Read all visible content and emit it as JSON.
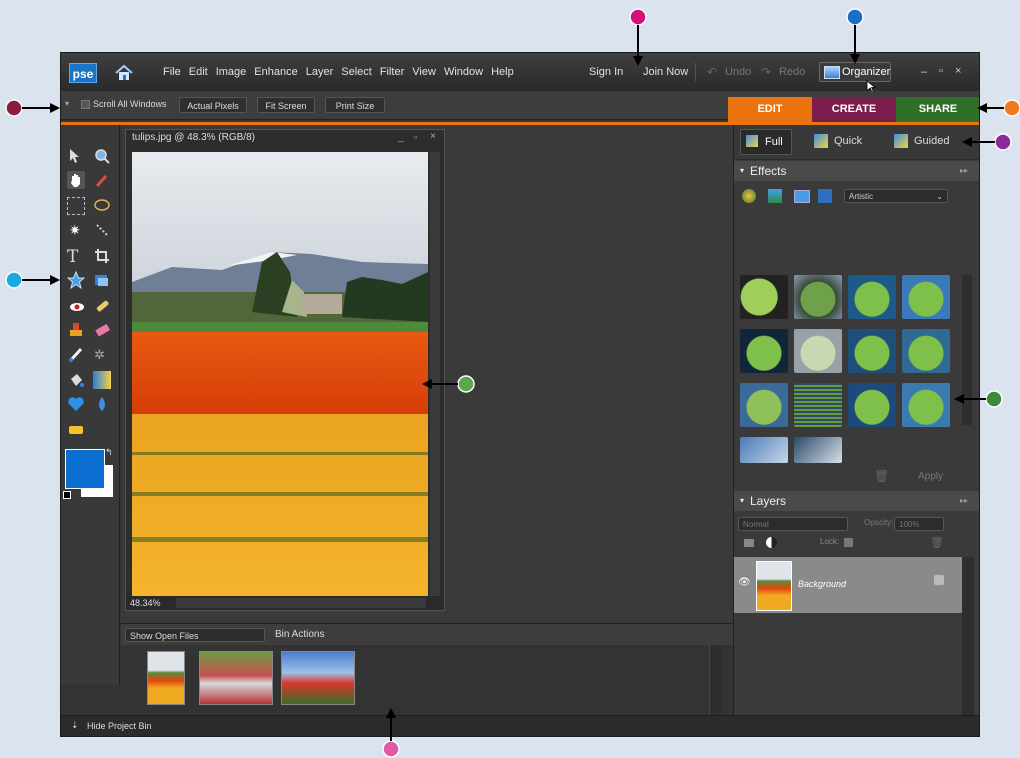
{
  "app": {
    "logo": "pse",
    "menus": [
      "File",
      "Edit",
      "Image",
      "Enhance",
      "Layer",
      "Select",
      "Filter",
      "View",
      "Window",
      "Help"
    ],
    "sign_in": "Sign In",
    "join_now": "Join Now",
    "undo": "Undo",
    "redo": "Redo",
    "organizer": "Organizer",
    "window_controls": [
      "–",
      "▫",
      "×"
    ]
  },
  "options": {
    "scroll_all": "Scroll All Windows",
    "actual_pixels": "Actual Pixels",
    "fit_screen": "Fit Screen",
    "print_size": "Print Size"
  },
  "tabs": [
    {
      "label": "EDIT",
      "color": "#e8730f"
    },
    {
      "label": "CREATE",
      "color": "#8a2152"
    },
    {
      "label": "SHARE",
      "color": "#3c7a2e"
    }
  ],
  "modes": {
    "full": "Full",
    "quick": "Quick",
    "guided": "Guided"
  },
  "document": {
    "title": "tulips.jpg @ 48.3% (RGB/8)",
    "zoom": "48.34%"
  },
  "effects": {
    "header": "Effects",
    "category": "Artistic",
    "apply": "Apply"
  },
  "layers": {
    "header": "Layers",
    "blend_mode": "Normal",
    "opacity_label": "Opacity:",
    "opacity_value": "100%",
    "lock_label": "Lock:",
    "layer_name": "Background"
  },
  "bin": {
    "show": "Show Open Files",
    "actions": "Bin Actions",
    "hide": "Hide Project Bin"
  },
  "callout_colors": {
    "maroon": "#8b1d3f",
    "magenta": "#d1127a",
    "blue": "#1a6fc4",
    "orange": "#ee7b1f",
    "purple": "#8a2a9b",
    "green": "#5aa64a",
    "cyan": "#1aa8e0",
    "pink": "#e05aa6"
  }
}
